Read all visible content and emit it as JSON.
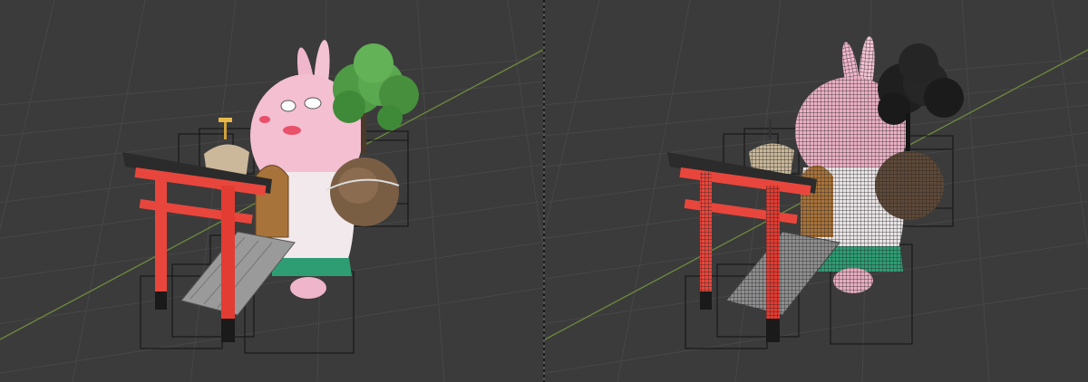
{
  "colors": {
    "background": "#3b3b3b",
    "grid": "#4a4a4a",
    "x_axis": "#8a4a4a",
    "y_axis": "#6e8a3e",
    "bunny_pink": "#f0b7cc",
    "torii_red": "#e8463c",
    "foliage_green": "#4f9a45",
    "skirt_green": "#2f9d74",
    "wood_brown": "#a8733a",
    "rock_brown": "#7a5e44",
    "stairs_gray": "#9a9a9a",
    "bounding_box": "#111111"
  },
  "viewports": [
    {
      "id": "solid",
      "shading": "solid"
    },
    {
      "id": "wireframe",
      "shading": "wireframe-overlay"
    }
  ]
}
